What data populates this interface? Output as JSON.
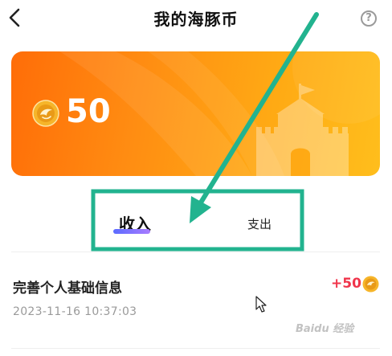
{
  "header": {
    "title": "我的海豚币",
    "back_icon": "chevron-left-icon",
    "help_icon": "question-circle-icon",
    "help_glyph": "?"
  },
  "balance_card": {
    "value": "50",
    "coin_icon": "dolphin-coin-icon",
    "decoration_icon": "castle-icon",
    "colors": {
      "gradient_start": "#ff6d08",
      "gradient_end": "#ffbe1c"
    }
  },
  "tabs": [
    {
      "label": "收入",
      "active": true
    },
    {
      "label": "支出",
      "active": false
    }
  ],
  "records": [
    {
      "title": "完善个人基础信息",
      "time": "2023-11-16 10:37:03",
      "amount": "+50",
      "amount_color": "#f0354b"
    }
  ],
  "annotation": {
    "color": "#22b38f"
  },
  "watermark": "Baidu 经验"
}
